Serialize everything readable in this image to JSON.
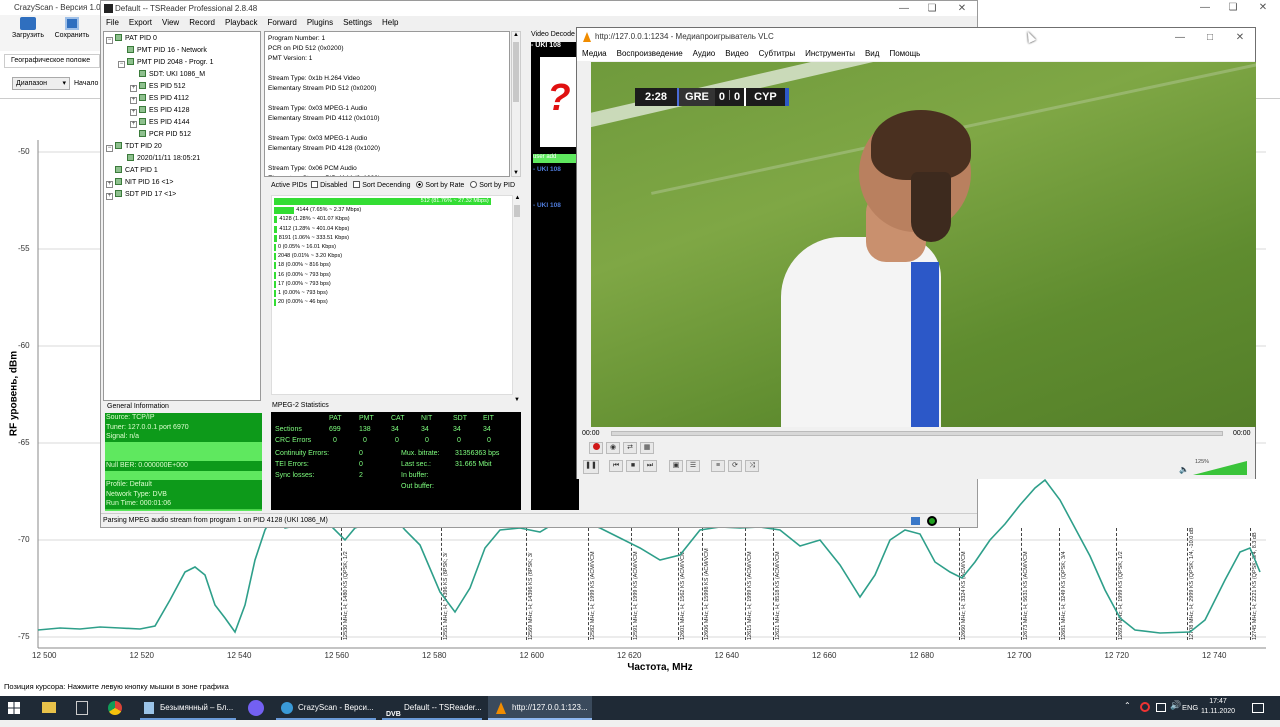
{
  "background_app": {
    "title": "CrazyScan - Версия 1.0",
    "toolbar": {
      "load_label": "Загрузить",
      "save_label": "Сохранить"
    },
    "geo_label": "Географическое положе",
    "range_select": "Диапазон",
    "start_label": "Начало",
    "ylabel": "RF уровень, dBm",
    "xlabel": "Частота, MHz",
    "status_text": "Позиция курсора: Нажмите левую кнопку мышки в зоне графика",
    "x_ticks": [
      "12 500",
      "12 520",
      "12 540",
      "12 560",
      "12 580",
      "12 600",
      "12 620",
      "12 640",
      "12 660",
      "12 680",
      "12 700",
      "12 720",
      "12 740"
    ],
    "y_ticks": [
      "-50",
      "-55",
      "-60",
      "-65",
      "-70",
      "-75"
    ],
    "markers": [
      "12530 MHz; H; 1480 KS (QPSK; 1/2",
      "12551 MHz; H; 14396 KS (8PSK; 3/",
      "12569 MHz; H; 14396 KS (8PSK; 3/",
      "12582 MHz; H; 1999 KS (ACM/VCM",
      "12591 MHz; H; 1999 KS (ACM/VCM",
      "12601 MHz; H; 1562 KS (ACM/VCM",
      "12606 MHz; H; 15998 KS (ACM/VCM",
      "12615 MHz; H; 1999 KS (ACM/VCM",
      "12621 MHz; H; 8518 KS (ACM/VCM",
      "12660 MHz; H; 3324 KS (ACM/VCM",
      "12673 MHz; H; 5631 KS (ACM/VCM",
      "12681 MHz; H; 3249 KS (QPSK; 3/4",
      "12693 MHz; H; 1999 KS (QPSK; 1/2",
      "12708 MHz; H; 2999 KS (QPSK; 1/4, -10.0 dB",
      "12745 MHz; H; 2221 KS (QPSK; 3/4, 8.3 dB"
    ]
  },
  "tsreader": {
    "title": "Default -- TSReader Professional 2.8.48",
    "menu": [
      "File",
      "Export",
      "View",
      "Record",
      "Playback",
      "Forward",
      "Plugins",
      "Settings",
      "Help"
    ],
    "tree": [
      {
        "label": "PAT PID 0",
        "indent": 0,
        "exp": "-"
      },
      {
        "label": "PMT PID 16 - Network",
        "indent": 1,
        "exp": ""
      },
      {
        "label": "PMT PID 2048 - Progr. 1",
        "indent": 1,
        "exp": "-"
      },
      {
        "label": "SDT: UKI 1086_M",
        "indent": 2,
        "exp": ""
      },
      {
        "label": "ES PID 512",
        "indent": 2,
        "exp": "+"
      },
      {
        "label": "ES PID 4112",
        "indent": 2,
        "exp": "+"
      },
      {
        "label": "ES PID 4128",
        "indent": 2,
        "exp": "+"
      },
      {
        "label": "ES PID 4144",
        "indent": 2,
        "exp": "+"
      },
      {
        "label": "PCR PID 512",
        "indent": 2,
        "exp": ""
      },
      {
        "label": "TDT PID 20",
        "indent": 0,
        "exp": "-"
      },
      {
        "label": "2020/11/11 18:05:21",
        "indent": 1,
        "exp": ""
      },
      {
        "label": "CAT PID 1",
        "indent": 0,
        "exp": ""
      },
      {
        "label": "NIT PID 16 <1>",
        "indent": 0,
        "exp": "+"
      },
      {
        "label": "SDT PID 17 <1>",
        "indent": 0,
        "exp": "+"
      }
    ],
    "program_info": [
      "Program Number: 1",
      "PCR on PID 512 (0x0200)",
      "PMT Version: 1",
      "",
      "Stream Type: 0x1b H.264 Video",
      "Elementary Stream PID 512 (0x0200)",
      "",
      "Stream Type: 0x03 MPEG-1 Audio",
      "Elementary Stream PID 4112 (0x1010)",
      "",
      "Stream Type: 0x03 MPEG-1 Audio",
      "Elementary Stream PID 4128 (0x1020)",
      "",
      "Stream Type: 0x06 PCM Audio",
      "Elementary Stream PID 4144 (0x1030)"
    ],
    "active_pids_label": "Active PIDs",
    "options": {
      "disabled": "Disabled",
      "sort_desc": "Sort Decending",
      "sort_rate": "Sort by Rate",
      "sort_pid": "Sort by PID"
    },
    "pids": [
      {
        "text": "512 (81.76% ~ 27.32 Mbps)",
        "fill": 0.8176
      },
      {
        "text": "4144 (7.65% ~ 2.37 Mbps)",
        "fill": 0.0765
      },
      {
        "text": "4128 (1.28% ~ 401.07 Kbps)",
        "fill": 0.0128
      },
      {
        "text": "4112 (1.28% ~ 401.04 Kbps)",
        "fill": 0.0128
      },
      {
        "text": "8191 (1.06% ~ 333.51 Kbps)",
        "fill": 0.0106
      },
      {
        "text": "0 (0.05% ~ 16.01 Kbps)",
        "fill": 0
      },
      {
        "text": "2048 (0.01% ~ 3.20 Kbps)",
        "fill": 0
      },
      {
        "text": "18 (0.00% ~ 816 bps)",
        "fill": 0
      },
      {
        "text": "16 (0.00% ~ 793 bps)",
        "fill": 0
      },
      {
        "text": "17 (0.00% ~ 793 bps)",
        "fill": 0
      },
      {
        "text": "1 (0.00% ~ 793 bps)",
        "fill": 0
      },
      {
        "text": "20 (0.00% ~ 46 bps)",
        "fill": 0
      }
    ],
    "general_info_label": "General Information",
    "general_info": [
      {
        "text": "Source: TCP/IP",
        "tone": "dark"
      },
      {
        "text": "Tuner: 127.0.0.1 port 6970",
        "tone": "dark"
      },
      {
        "text": "Signal: n/a",
        "tone": "dark"
      },
      {
        "text": "",
        "tone": "light"
      },
      {
        "text": "",
        "tone": "light"
      },
      {
        "text": "Null BER: 0.000000E+000",
        "tone": "dark"
      },
      {
        "text": "",
        "tone": "light"
      },
      {
        "text": "Profile: Default",
        "tone": "dark"
      },
      {
        "text": "Network Type: DVB",
        "tone": "dark"
      },
      {
        "text": "Run Time: 000:01:06",
        "tone": "dark"
      }
    ],
    "stats_label": "MPEG-2 Statistics",
    "stats": {
      "headers": [
        "PAT",
        "PMT",
        "CAT",
        "NIT",
        "SDT",
        "EIT"
      ],
      "sections": {
        "label": "Sections",
        "values": [
          "699",
          "138",
          "34",
          "34",
          "34",
          "34"
        ]
      },
      "crc": {
        "label": "CRC Errors",
        "values": [
          "0",
          "0",
          "0",
          "0",
          "0",
          "0"
        ]
      },
      "left": [
        {
          "k": "Continuity Errors:",
          "v": "0"
        },
        {
          "k": "TEI Errors:",
          "v": "0"
        },
        {
          "k": "Sync losses:",
          "v": "2"
        }
      ],
      "right": [
        {
          "k": "Mux. bitrate:",
          "v": "31356363 bps"
        },
        {
          "k": "Last sec.:",
          "v": "31.665 Mbit"
        },
        {
          "k": "In buffer:",
          "v": ""
        },
        {
          "k": "Out buffer:",
          "v": ""
        }
      ]
    },
    "video_decoder_label": "Video Decode",
    "video_channel": "- UKI 108",
    "decoder_user_label": "user add",
    "decoder_lines": [
      "- UKI 108",
      "- UKI 108"
    ],
    "status_text": "Parsing MPEG audio stream from program 1 on PID 4128 (UKI 1086_M)"
  },
  "vlc": {
    "title": "http://127.0.0.1:1234 - Медиапроигрыватель VLC",
    "menu": [
      "Медиа",
      "Воспроизведение",
      "Аудио",
      "Видео",
      "Субтитры",
      "Инструменты",
      "Вид",
      "Помощь"
    ],
    "score": {
      "time": "2:28",
      "home": "GRE",
      "home_goals": "0",
      "away_goals": "0",
      "away": "CYP"
    },
    "time_elapsed": "00:00",
    "time_total": "00:00",
    "volume": "125%",
    "volume_level": 1.25
  },
  "taskbar": {
    "items": [
      {
        "label": "Безымянный – Бл..."
      },
      {
        "label": "CrazyScan - Верси..."
      },
      {
        "label": "Default -- TSReader..."
      },
      {
        "label": "http://127.0.0.1:123..."
      }
    ],
    "lang": "ENG",
    "time": "17:47",
    "date": "11.11.2020"
  },
  "colors": {
    "accent": "#0078d7",
    "spectrum": "#2e9f8a",
    "pid_green": "#33dd33"
  }
}
